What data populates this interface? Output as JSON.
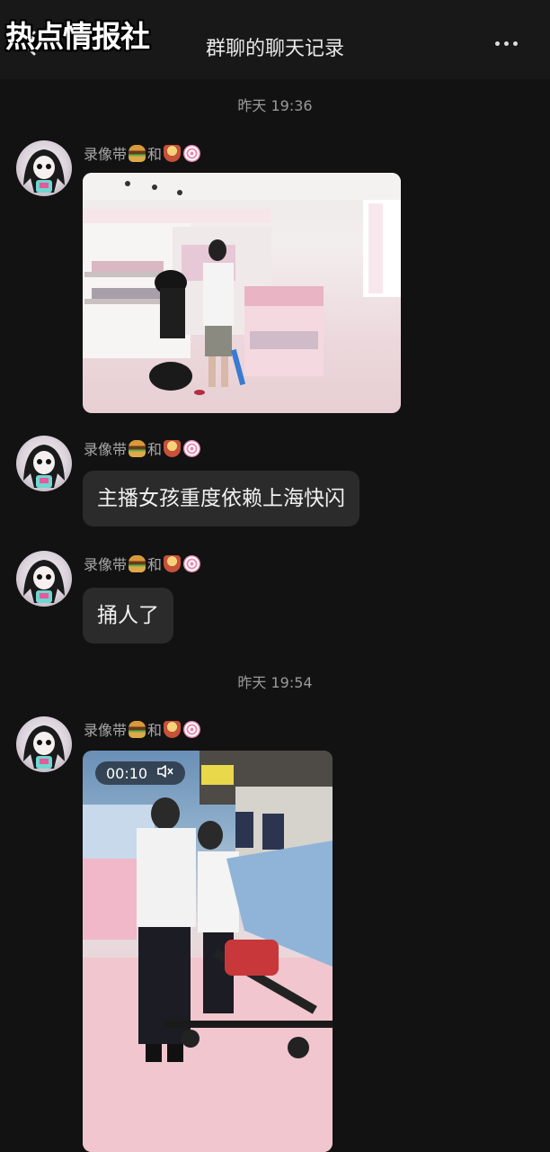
{
  "header": {
    "watermark": "热点情报社",
    "title": "群聊的聊天记录"
  },
  "timestamps": [
    "昨天 19:36",
    "昨天 19:54"
  ],
  "messages": [
    {
      "sender": "录像带",
      "sender_mid": "和",
      "type": "image"
    },
    {
      "sender": "录像带",
      "sender_mid": "和",
      "type": "text",
      "text": "主播女孩重度依赖上海快闪"
    },
    {
      "sender": "录像带",
      "sender_mid": "和",
      "type": "text",
      "text": "捅人了"
    },
    {
      "sender": "录像带",
      "sender_mid": "和",
      "type": "video",
      "duration": "00:10"
    }
  ],
  "icons": {
    "back": "chevron-left-icon",
    "more": "more-dots-icon",
    "mute": "muted-speaker-icon",
    "sender_emojis": [
      "hamburger-emoji",
      "ramen-emoji",
      "naruto-swirl-emoji"
    ]
  },
  "colors": {
    "background": "#121212",
    "bubble": "#2b2b2b",
    "text_secondary": "#9a9a9a"
  }
}
